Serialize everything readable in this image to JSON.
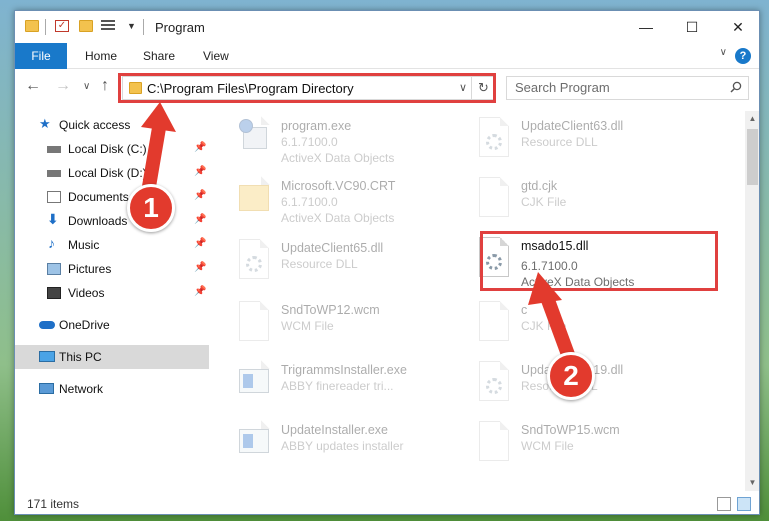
{
  "window": {
    "title": "Program",
    "min_glyph": "—",
    "max_glyph": "☐",
    "close_glyph": "✕"
  },
  "ribbon": {
    "tabs": [
      "File",
      "Home",
      "Share",
      "View"
    ],
    "help": "?",
    "collapse": "∨"
  },
  "nav": {
    "back": "←",
    "forward": "→",
    "recent": "∨",
    "up": "↑"
  },
  "address": {
    "path": "C:\\Program Files\\Program Directory",
    "dropdown": "∨",
    "refresh": "↻"
  },
  "search": {
    "placeholder": "Search Program"
  },
  "sidebar": {
    "items": [
      {
        "label": "Quick access",
        "icon": "star-icon"
      },
      {
        "label": "Local Disk (C:)",
        "icon": "drive-icon",
        "pinned": true
      },
      {
        "label": "Local Disk (D:)",
        "icon": "drive-icon",
        "pinned": true
      },
      {
        "label": "Documents",
        "icon": "documents-icon",
        "pinned": true
      },
      {
        "label": "Downloads",
        "icon": "downloads-icon",
        "pinned": true
      },
      {
        "label": "Music",
        "icon": "music-icon",
        "pinned": true
      },
      {
        "label": "Pictures",
        "icon": "pictures-icon",
        "pinned": true
      },
      {
        "label": "Videos",
        "icon": "videos-icon",
        "pinned": true
      },
      {
        "label": "OneDrive",
        "icon": "cloud-icon"
      },
      {
        "label": "This PC",
        "icon": "computer-icon",
        "selected": true
      },
      {
        "label": "Network",
        "icon": "network-icon"
      }
    ],
    "pin_glyph": "📌"
  },
  "files": [
    {
      "name": "program.exe",
      "line2": "6.1.7100.0",
      "line3": "ActiveX Data Objects",
      "kind": "setup"
    },
    {
      "name": "UpdateClient63.dll",
      "line2": "Resource DLL",
      "line3": "",
      "kind": "dll"
    },
    {
      "name": "Microsoft.VC90.CRT",
      "line2": "6.1.7100.0",
      "line3": "ActiveX Data Objects",
      "kind": "folder"
    },
    {
      "name": "gtd.cjk",
      "line2": "CJK File",
      "line3": "",
      "kind": "blank"
    },
    {
      "name": "UpdateClient65.dll",
      "line2": "Resource DLL",
      "line3": "",
      "kind": "dll"
    },
    {
      "name": "msado15.dll",
      "line2": "6.1.7100.0",
      "line3": "ActiveX Data Objects",
      "kind": "dll"
    },
    {
      "name": "SndToWP12.wcm",
      "line2": "WCM File",
      "line3": "",
      "kind": "blank"
    },
    {
      "name": "c",
      "line2": "CJK File",
      "line3": "",
      "kind": "blank"
    },
    {
      "name": "TrigrammsInstaller.exe",
      "line2": "ABBY finereader tri...",
      "line3": "",
      "kind": "exe"
    },
    {
      "name": "UpdateClient19.dll",
      "line2": "Resource DLL",
      "line3": "",
      "kind": "dll"
    },
    {
      "name": "UpdateInstaller.exe",
      "line2": "ABBY updates installer",
      "line3": "",
      "kind": "exe"
    },
    {
      "name": "SndToWP15.wcm",
      "line2": "WCM File",
      "line3": "",
      "kind": "blank"
    }
  ],
  "status": {
    "count": "171 items"
  },
  "annotations": {
    "badge1": "1",
    "badge2": "2",
    "accent": "#e0403f"
  }
}
